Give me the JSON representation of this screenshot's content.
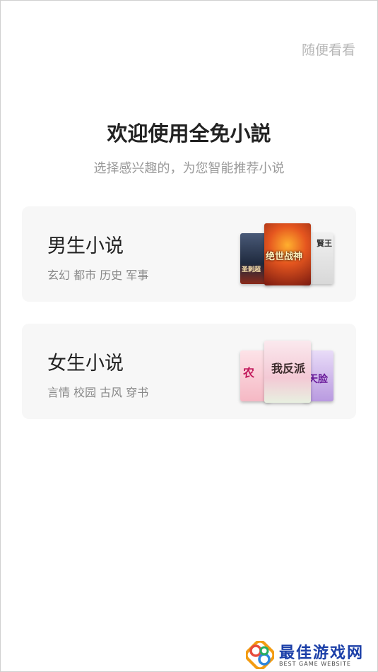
{
  "skip_label": "随便看看",
  "welcome": {
    "title": "欢迎使用全免小説",
    "subtitle": "选择感兴趣的，为您智能推荐小说"
  },
  "categories": [
    {
      "title": "男生小说",
      "tags": "玄幻 都市 历史 军事",
      "covers": [
        {
          "text": "圣刺超",
          "color": "#2a3a55"
        },
        {
          "text": "绝世战神",
          "color": "#c0371a"
        },
        {
          "text": "賢王",
          "color": "#e8e8e8"
        }
      ]
    },
    {
      "title": "女生小说",
      "tags": "言情 校园 古风 穿书",
      "covers": [
        {
          "text": "农",
          "color": "#f7c6cf"
        },
        {
          "text": "我反派",
          "color": "#f4d8e0"
        },
        {
          "text": "天脸",
          "color": "#d9c7f0"
        }
      ]
    }
  ],
  "watermark": {
    "name": "最佳游戏网",
    "tagline": "BEST GAME WEBSITE"
  }
}
